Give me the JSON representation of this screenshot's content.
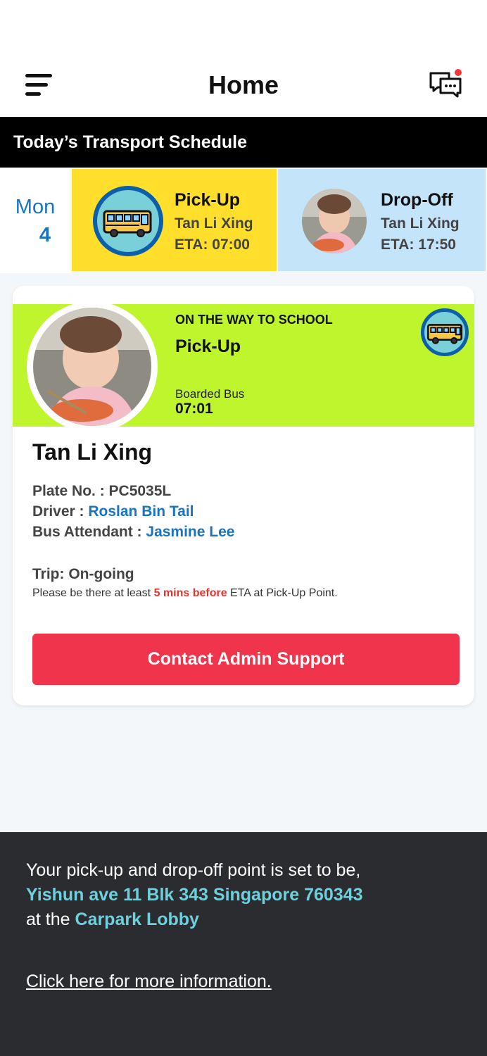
{
  "header": {
    "title": "Home",
    "menu_icon": "hamburger-menu-icon",
    "chat_icon": "chat-bubbles-icon",
    "notification_color": "#f03a3a"
  },
  "schedule": {
    "heading": "Today’s Transport Schedule",
    "day": {
      "name": "Mon",
      "number": "4"
    },
    "pickup": {
      "title": "Pick-Up",
      "student": "Tan Li Xing",
      "eta": "ETA: 07:00",
      "icon": "school-bus-icon",
      "color": "#ffdf2c"
    },
    "dropoff": {
      "title": "Drop-Off",
      "student": "Tan Li Xing",
      "eta": "ETA: 17:50",
      "color": "#c4e4fa"
    }
  },
  "trip_card": {
    "status_label": "ON THE WAY TO SCHOOL",
    "trip_type": "Pick-Up",
    "boarded_label": "Boarded Bus",
    "boarded_time": "07:01",
    "status_color": "#bff52d",
    "student_name": "Tan Li Xing",
    "plate_label": "Plate No. : PC5035L",
    "driver_label": "Driver : ",
    "driver_name": "Roslan Bin Tail",
    "attendant_label": "Bus Attendant : ",
    "attendant_name": "Jasmine Lee",
    "trip_status": "Trip: On-going",
    "notice_prefix": "Please be there at least ",
    "notice_highlight": "5 mins before",
    "notice_suffix": " ETA at Pick-Up Point.",
    "contact_button": "Contact Admin Support",
    "button_color": "#f0344b"
  },
  "footer": {
    "line1": "Your pick-up and drop-off point is set to be,",
    "address": "Yishun ave 11 Blk 343 Singapore 760343",
    "line3_prefix": "at the ",
    "location": "Carpark Lobby",
    "more_info_link": "Click here for more information."
  }
}
